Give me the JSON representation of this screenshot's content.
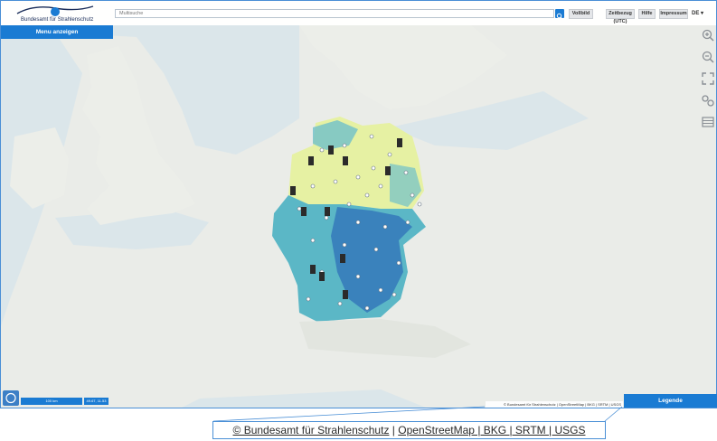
{
  "header": {
    "logo_text": "Bundesamt für Strahlenschutz",
    "menu_button": "Menu anzeigen",
    "search_placeholder": "Multisuche",
    "buttons": {
      "vollbild": "Vollbild",
      "zeitbezug": "Zeitbezug (UTC)",
      "hilfe": "Hilfe",
      "impressum": "Impressum"
    },
    "language": "DE",
    "language_arrow": "▾"
  },
  "map_tools": [
    "zoom-in-icon",
    "zoom-out-icon",
    "fullscreen-icon",
    "share-link-icon",
    "layers-icon"
  ],
  "footer": {
    "scale": "100 km",
    "coordinates": "49.67, 11.53",
    "attribution_small": {
      "bfs": "© Bundesamt für Strahlenschutz",
      "sep": "|",
      "osm": "OpenStreetMap | BKG | SRTM | USGS"
    },
    "legend_button": "Legende"
  },
  "zoom_attribution": {
    "bfs": "© Bundesamt für Strahlenschutz",
    "separator": "|",
    "osm": "OpenStreetMap | BKG | SRTM | USGS"
  },
  "colors": {
    "accent": "#1a7bd3",
    "map_land": "#e8ebe6",
    "sea": "#d6e5ea",
    "germany_light": "#e8f2a6",
    "germany_teal": "#57b8c7",
    "germany_dark": "#2a6cb5"
  }
}
